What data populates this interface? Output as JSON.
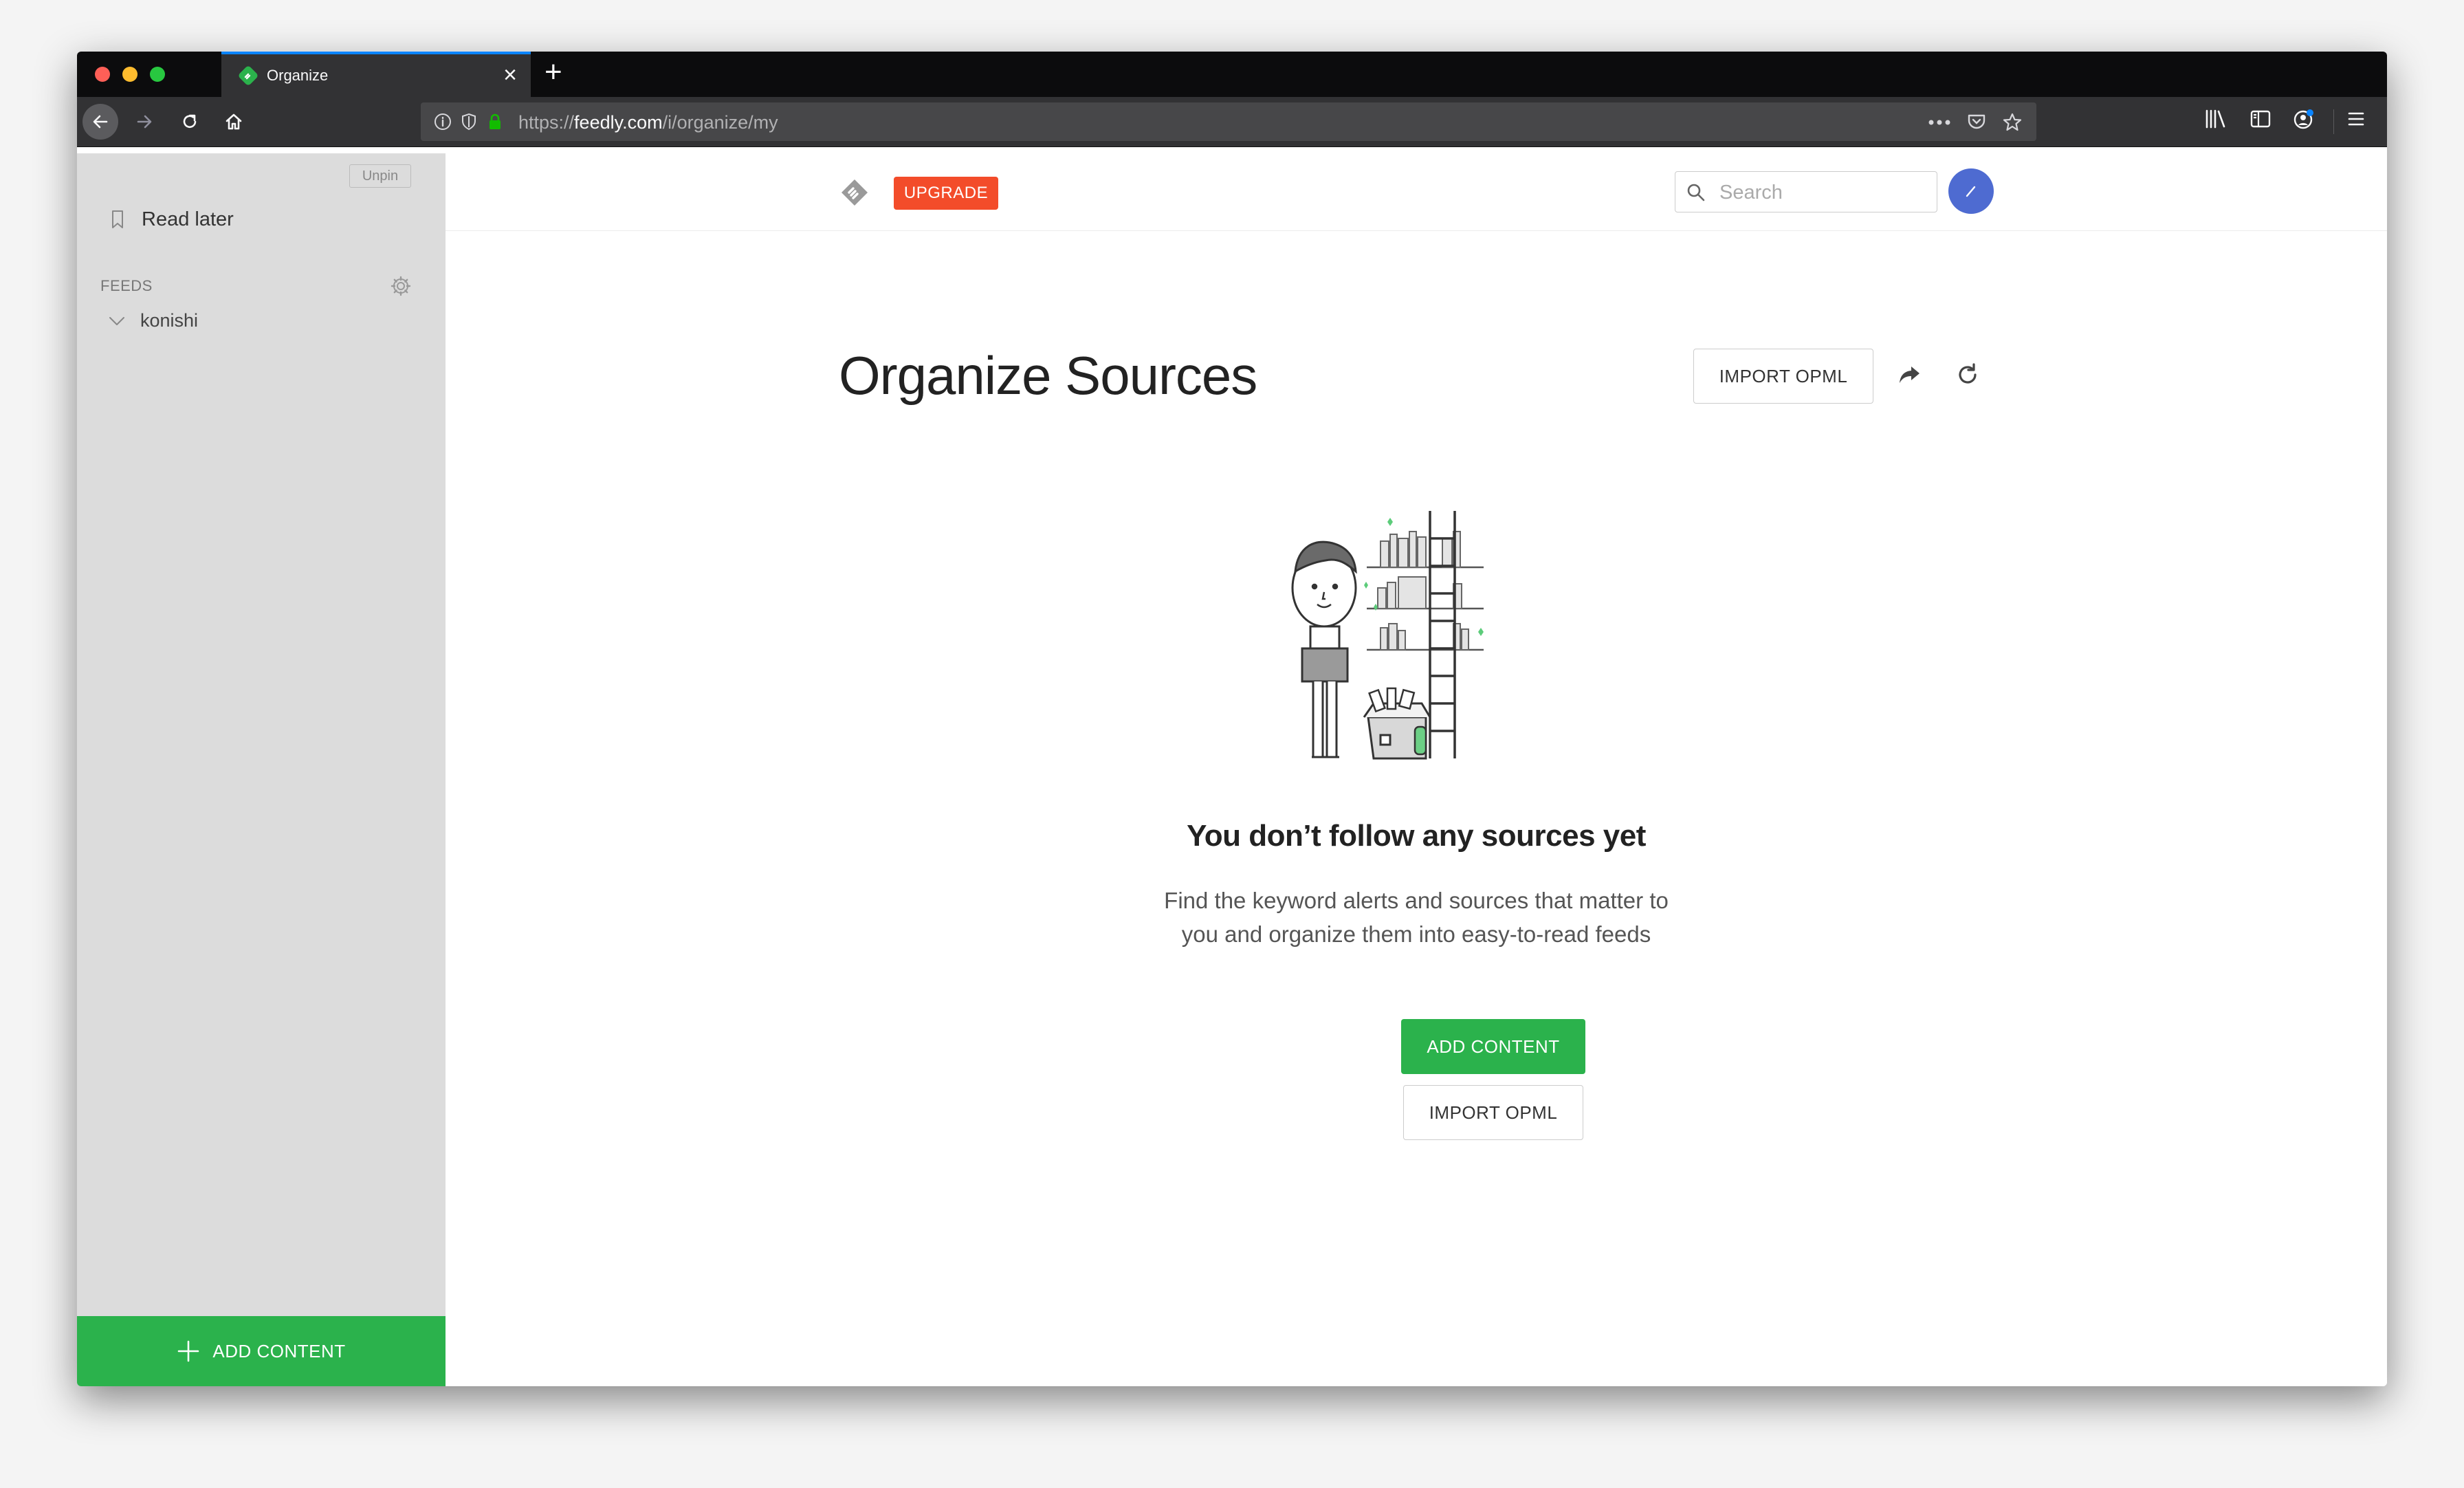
{
  "browser": {
    "tab_title": "Organize",
    "url_prefix": "https://",
    "url_domain": "feedly.com",
    "url_path": "/i/organize/my"
  },
  "sidebar": {
    "unpin_label": "Unpin",
    "read_later_label": "Read later",
    "feeds_heading": "FEEDS",
    "feeds": [
      {
        "label": "konishi"
      }
    ],
    "add_content_label": "ADD CONTENT"
  },
  "header": {
    "upgrade_label": "UPGRADE",
    "search_placeholder": "Search"
  },
  "main": {
    "title": "Organize Sources",
    "import_opml_label": "IMPORT OPML",
    "empty_title": "You don’t follow any sources yet",
    "empty_text": "Find the keyword alerts and sources that matter to you and organize them into easy-to-read feeds",
    "add_content_label": "ADD CONTENT",
    "import_opml_button_label": "IMPORT OPML"
  },
  "colors": {
    "accent_green": "#2bb24c",
    "upgrade_orange": "#f34c2a",
    "avatar_blue": "#4e6bd1",
    "sidebar_bg": "#dcdcdc"
  },
  "icons": [
    "feedly-logo-icon",
    "bookmark-icon",
    "gear-icon",
    "chevron-down-icon",
    "plus-icon",
    "search-icon",
    "share-icon",
    "refresh-icon",
    "back-icon",
    "forward-icon",
    "reload-icon",
    "home-icon"
  ]
}
